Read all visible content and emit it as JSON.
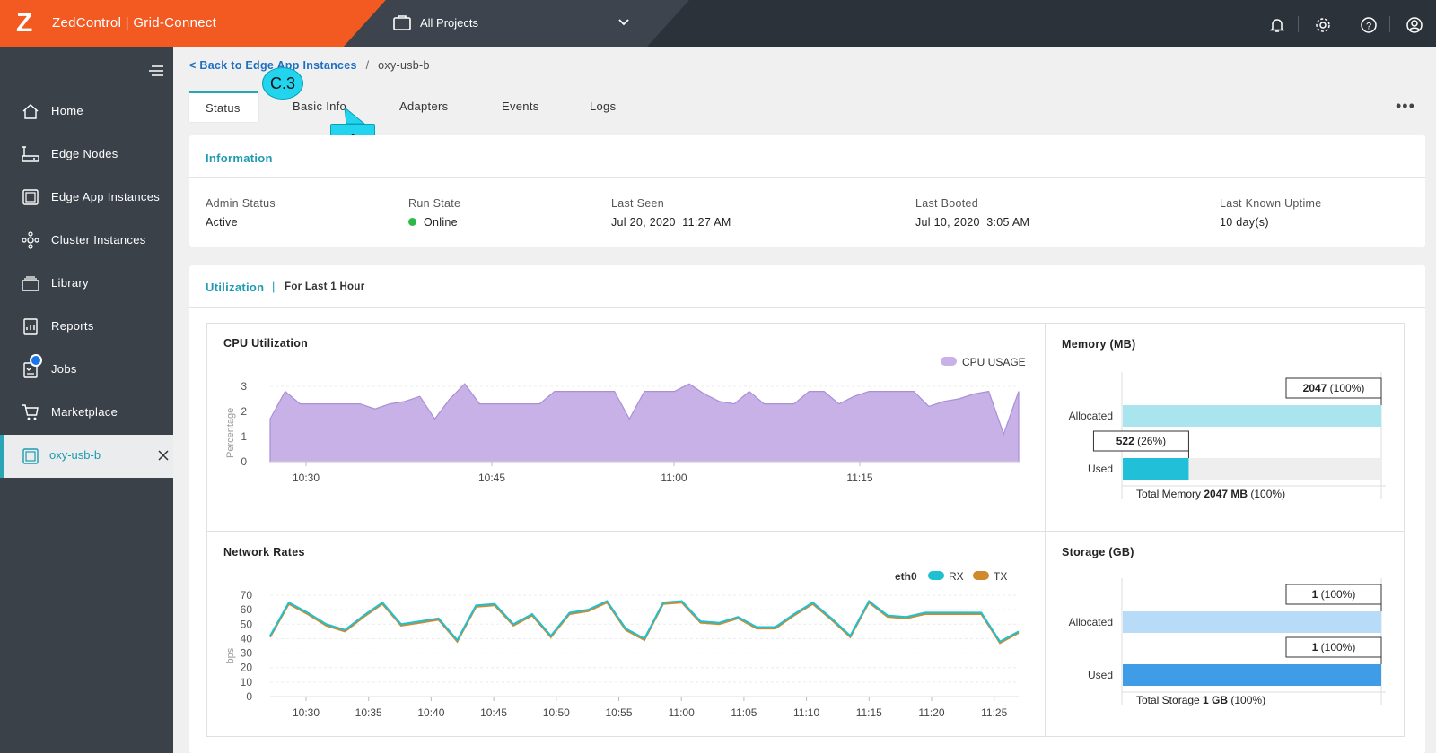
{
  "header": {
    "logo_letter": "Z",
    "app_title": "ZedControl | Grid-Connect",
    "project_selector": "All Projects",
    "icons": [
      "bell-icon",
      "gear-icon",
      "help-icon",
      "user-icon"
    ]
  },
  "sidebar": {
    "items": [
      {
        "label": "Home",
        "icon": "home-icon"
      },
      {
        "label": "Edge Nodes",
        "icon": "edge-node-icon"
      },
      {
        "label": "Edge App Instances",
        "icon": "app-instance-icon"
      },
      {
        "label": "Cluster Instances",
        "icon": "cluster-icon"
      },
      {
        "label": "Library",
        "icon": "library-icon"
      },
      {
        "label": "Reports",
        "icon": "reports-icon"
      },
      {
        "label": "Jobs",
        "icon": "jobs-icon"
      },
      {
        "label": "Marketplace",
        "icon": "cart-icon"
      }
    ],
    "active_instance": "oxy-usb-b"
  },
  "breadcrumb": {
    "back_link": "< Back to Edge App Instances",
    "separator": "/",
    "current": "oxy-usb-b"
  },
  "tabs": [
    "Status",
    "Basic Info",
    "Adapters",
    "Events",
    "Logs"
  ],
  "annotations": {
    "circle": "C.3",
    "box": "1"
  },
  "information": {
    "title": "Information",
    "fields": [
      {
        "label": "Admin Status",
        "value": "Active"
      },
      {
        "label": "Run State",
        "value": "Online"
      },
      {
        "label": "Last Seen",
        "value": "Jul 20, 2020  11:27 AM"
      },
      {
        "label": "Last Booted",
        "value": "Jul 10, 2020  3:05 AM"
      },
      {
        "label": "Last Known Uptime",
        "value": "10 day(s)"
      }
    ]
  },
  "utilization": {
    "title": "Utilization",
    "separator": "|",
    "subtitle": "For Last 1 Hour"
  },
  "chart_data": [
    {
      "type": "area",
      "title": "CPU Utilization",
      "ylabel": "Percentage",
      "ylim": [
        0,
        3
      ],
      "yticks": [
        0,
        1,
        2,
        3
      ],
      "x_tick_labels": [
        "10:30",
        "10:45",
        "11:00",
        "11:15"
      ],
      "legend": [
        "CPU USAGE"
      ],
      "color": "#c7b1e6",
      "series": [
        {
          "name": "CPU USAGE",
          "values": [
            1.7,
            2.8,
            2.3,
            2.3,
            2.3,
            2.3,
            2.3,
            2.1,
            2.3,
            2.4,
            2.6,
            1.7,
            2.5,
            3.1,
            2.3,
            2.3,
            2.3,
            2.3,
            2.3,
            2.8,
            2.8,
            2.8,
            2.8,
            2.8,
            1.7,
            2.8,
            2.8,
            2.8,
            3.1,
            2.7,
            2.4,
            2.3,
            2.8,
            2.3,
            2.3,
            2.3,
            2.8,
            2.8,
            2.3,
            2.6,
            2.8,
            2.8,
            2.8,
            2.8,
            2.2,
            2.4,
            2.5,
            2.7,
            2.8,
            1.1,
            2.8
          ]
        }
      ]
    },
    {
      "type": "bar",
      "title": "Memory (MB)",
      "categories": [
        "Allocated",
        "Used"
      ],
      "values": [
        2047,
        522
      ],
      "max": 2047,
      "labels": [
        {
          "value": "2047",
          "pct": "(100%)"
        },
        {
          "value": "522",
          "pct": "(26%)"
        }
      ],
      "total_prefix": "Total Memory",
      "total_value": "2047 MB",
      "total_pct": "(100%)",
      "colors": [
        "#a9e5ef",
        "#22c0d8"
      ]
    },
    {
      "type": "line",
      "title": "Network Rates",
      "ylabel": "bps",
      "ylim": [
        0,
        70
      ],
      "yticks": [
        0,
        10,
        20,
        30,
        40,
        50,
        60,
        70
      ],
      "x_tick_labels": [
        "10:30",
        "10:35",
        "10:40",
        "10:45",
        "10:50",
        "10:55",
        "11:00",
        "11:05",
        "11:10",
        "11:15",
        "11:20",
        "11:25"
      ],
      "legend_title": "eth0",
      "series": [
        {
          "name": "RX",
          "color": "#1fc0d0",
          "values": [
            42,
            65,
            58,
            50,
            46,
            56,
            65,
            50,
            52,
            54,
            39,
            63,
            64,
            50,
            57,
            42,
            58,
            60,
            66,
            47,
            40,
            65,
            66,
            52,
            51,
            55,
            48,
            48,
            57,
            65,
            54,
            42,
            66,
            56,
            55,
            58,
            58,
            58,
            58,
            38,
            45
          ]
        },
        {
          "name": "TX",
          "color": "#cf8a2e",
          "values": [
            41,
            64,
            57,
            49,
            45,
            55,
            64,
            49,
            51,
            53,
            38,
            62,
            63,
            49,
            56,
            41,
            57,
            59,
            65,
            46,
            39,
            64,
            65,
            51,
            50,
            54,
            47,
            47,
            56,
            64,
            53,
            41,
            65,
            55,
            54,
            57,
            57,
            57,
            57,
            37,
            44
          ]
        }
      ]
    },
    {
      "type": "bar",
      "title": "Storage (GB)",
      "categories": [
        "Allocated",
        "Used"
      ],
      "values": [
        1,
        1
      ],
      "max": 1,
      "labels": [
        {
          "value": "1",
          "pct": "(100%)"
        },
        {
          "value": "1",
          "pct": "(100%)"
        }
      ],
      "total_prefix": "Total Storage",
      "total_value": "1 GB",
      "total_pct": "(100%)",
      "colors": [
        "#b8dcf7",
        "#3f9de8"
      ]
    }
  ]
}
